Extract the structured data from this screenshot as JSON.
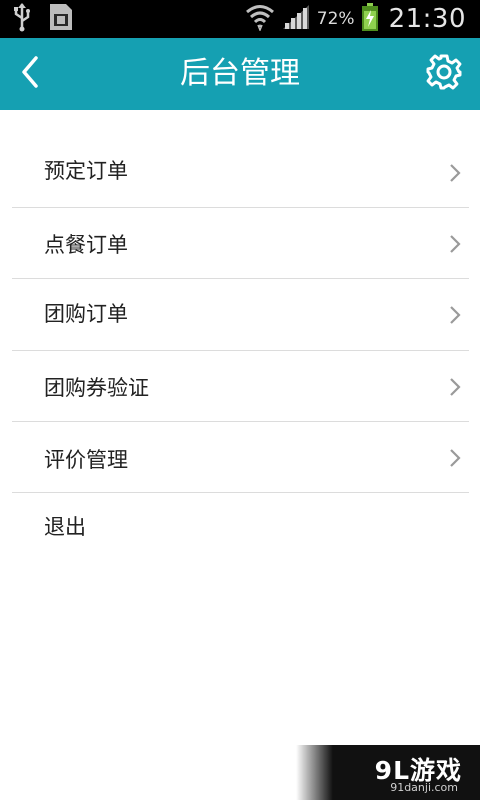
{
  "status_bar": {
    "battery_percent": "72%",
    "time": "21:30",
    "icons": [
      "usb-icon",
      "sd-card-icon",
      "wifi-icon",
      "signal-icon",
      "battery-charging-icon"
    ]
  },
  "header": {
    "title": "后台管理",
    "back_icon": "back-arrow-icon",
    "settings_icon": "gear-icon",
    "background_color": "#15a0b2"
  },
  "menu": {
    "items": [
      {
        "label": "预定订单",
        "has_chevron": true
      },
      {
        "label": "点餐订单",
        "has_chevron": true
      },
      {
        "label": "团购订单",
        "has_chevron": true
      },
      {
        "label": "团购券验证",
        "has_chevron": true
      },
      {
        "label": "评价管理",
        "has_chevron": true
      },
      {
        "label": "退出",
        "has_chevron": false
      }
    ]
  },
  "watermark": {
    "logo": "9L游戏",
    "url": "91danji.com"
  }
}
